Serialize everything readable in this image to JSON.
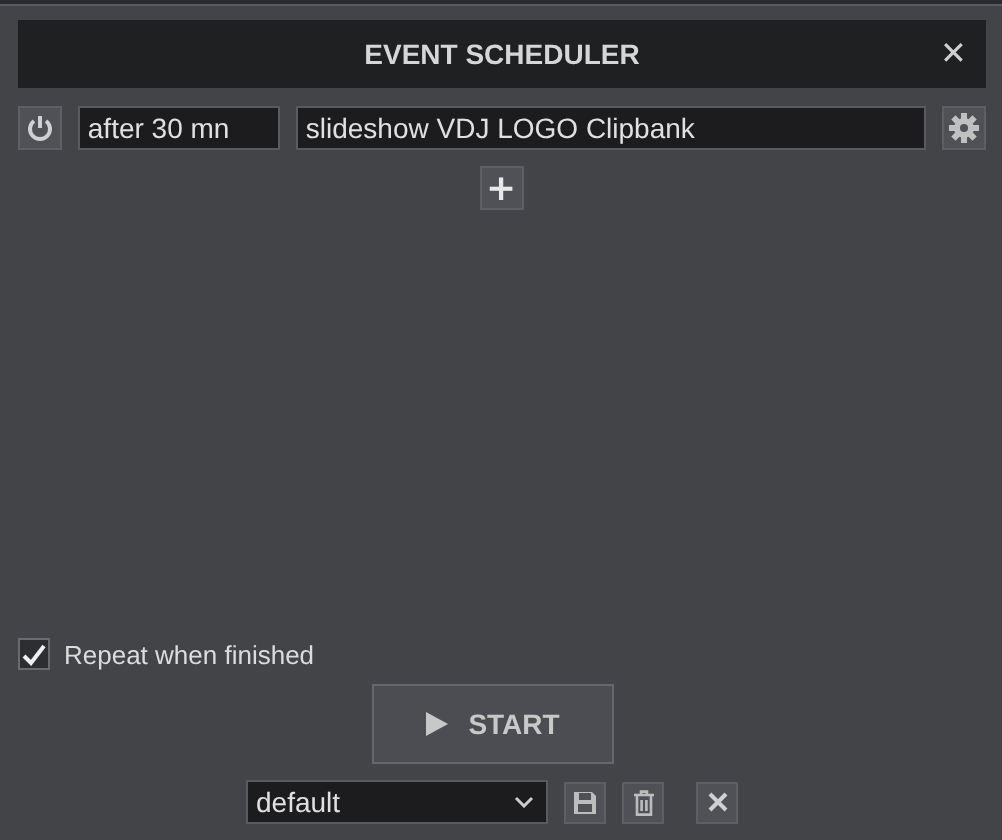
{
  "window": {
    "title": "EVENT SCHEDULER",
    "close": "✕"
  },
  "events": [
    {
      "time": "after 30 mn",
      "action": "slideshow VDJ LOGO Clipbank"
    }
  ],
  "add_button": "+",
  "repeat": {
    "label": "Repeat when finished",
    "checked": true
  },
  "start_button": {
    "label": "START"
  },
  "preset": {
    "value": "default"
  }
}
